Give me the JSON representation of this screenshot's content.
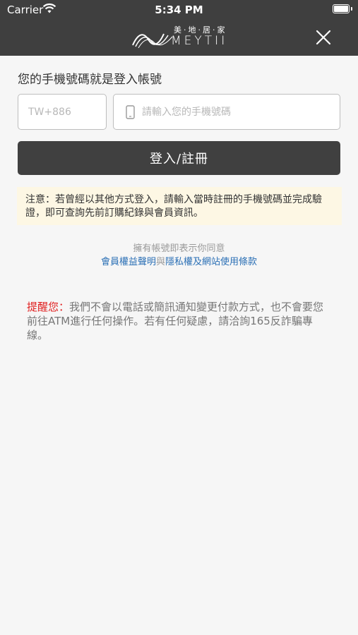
{
  "status": {
    "carrier": "Carrier",
    "time": "5:34 PM"
  },
  "logo": {
    "cn": "美·地·居·家",
    "en": "MEYTII"
  },
  "heading": "您的手機號碼就是登入帳號",
  "country_field": {
    "placeholder": "TW+886"
  },
  "phone_field": {
    "placeholder": "請輸入您的手機號碼",
    "icon": "phone-icon"
  },
  "login_button": "登入/註冊",
  "notice": "注意：若曾經以其他方式登入，請輸入當時註冊的手機號碼並完成驗證，即可查詢先前訂購紀錄與會員資訊。",
  "agree": {
    "text": "擁有帳號即表示你同意",
    "link_terms": "會員權益聲明",
    "separator": "與",
    "link_privacy": "隱私權及網站使用條款"
  },
  "reminder": {
    "label": "提醒您：",
    "text": "我們不會以電話或簡訊通知變更付款方式，也不會要您前往ATM進行任何操作。若有任何疑慮，請洽詢165反詐騙專線。"
  },
  "colors": {
    "header": "#3f3f3f",
    "button": "#404040",
    "notice_bg": "#fdf7e4",
    "link": "#2a6fb5",
    "alert": "#e02020"
  }
}
